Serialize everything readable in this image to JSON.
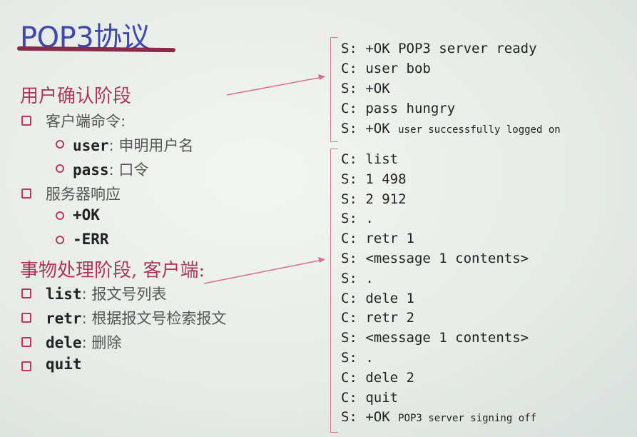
{
  "title": "POP3协议",
  "auth": {
    "heading": "用户确认阶段",
    "client_cmds": "客户端命令:",
    "user_cmd": "user",
    "user_desc": ": 申明用户名",
    "pass_cmd": "pass",
    "pass_desc": ": 口令",
    "server_resp": "服务器响应",
    "ok": "+OK",
    "err": "-ERR"
  },
  "trans": {
    "heading": "事物处理阶段, 客户端:",
    "list_cmd": "list",
    "list_desc": ": 报文号列表",
    "retr_cmd": "retr",
    "retr_desc": ": 根据报文号检索报文",
    "dele_cmd": "dele",
    "dele_desc": ": 删除",
    "quit_cmd": "quit"
  },
  "dialog_auth": [
    {
      "p": "S:",
      "t": "+OK POP3 server ready",
      "s": ""
    },
    {
      "p": "C:",
      "t": "user bob",
      "s": ""
    },
    {
      "p": "S:",
      "t": "+OK",
      "s": ""
    },
    {
      "p": "C:",
      "t": "pass hungry",
      "s": ""
    },
    {
      "p": "S:",
      "t": "+OK",
      "s": "user successfully logged on"
    }
  ],
  "dialog_trans": [
    {
      "p": "C:",
      "t": "list",
      "s": ""
    },
    {
      "p": "S:",
      "t": "1 498",
      "s": ""
    },
    {
      "p": "S:",
      "t": "2 912",
      "s": ""
    },
    {
      "p": "S:",
      "t": ".",
      "s": ""
    },
    {
      "p": "C:",
      "t": "retr 1",
      "s": ""
    },
    {
      "p": "S:",
      "t": "<message 1 contents>",
      "s": ""
    },
    {
      "p": "S:",
      "t": ".",
      "s": ""
    },
    {
      "p": "C:",
      "t": "dele 1",
      "s": ""
    },
    {
      "p": "C:",
      "t": "retr 2",
      "s": ""
    },
    {
      "p": "S:",
      "t": "<message 1 contents>",
      "s": ""
    },
    {
      "p": "S:",
      "t": ".",
      "s": ""
    },
    {
      "p": "C:",
      "t": "dele 2",
      "s": ""
    },
    {
      "p": "C:",
      "t": "quit",
      "s": ""
    },
    {
      "p": "S:",
      "t": "+OK",
      "s": "POP3 server signing off"
    }
  ]
}
